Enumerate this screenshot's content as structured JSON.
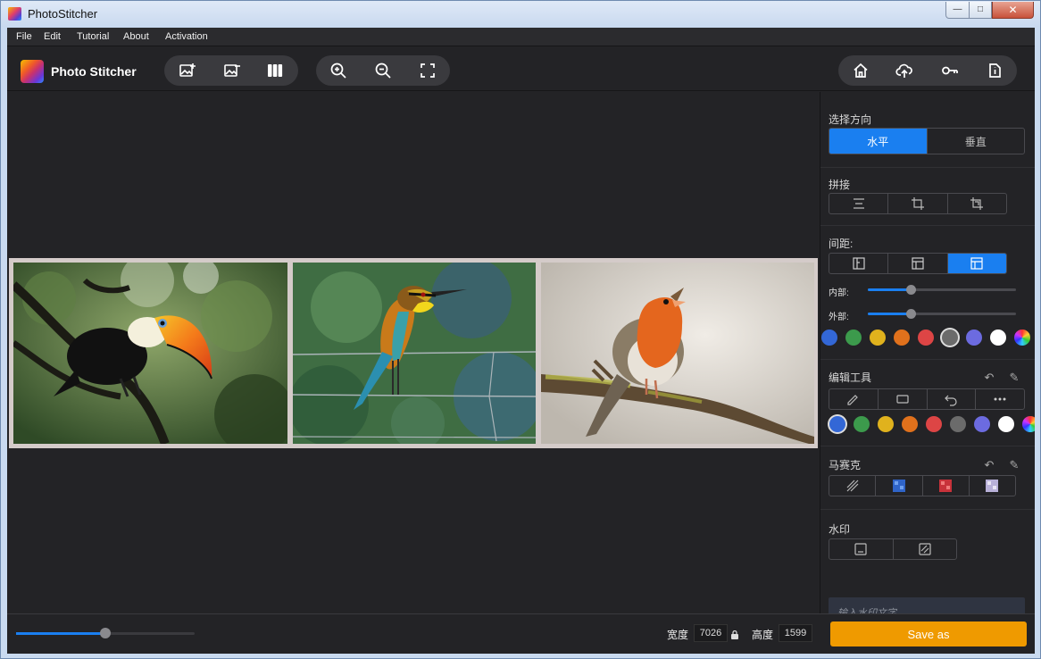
{
  "window": {
    "title": "PhotoStitcher",
    "controls": {
      "minimize": "—",
      "maximize": "□",
      "close": "✕"
    }
  },
  "menu": [
    "File",
    "Edit",
    "Tutorial",
    "About",
    "Activation"
  ],
  "app": {
    "name": "Photo Stitcher"
  },
  "toolbar": {
    "group1": [
      "add-image-icon",
      "remove-image-icon",
      "columns-icon"
    ],
    "group2": [
      "zoom-in-icon",
      "zoom-out-icon",
      "fit-screen-icon"
    ],
    "group3": [
      "home-icon",
      "upload-icon",
      "key-icon",
      "info-icon"
    ]
  },
  "photos": [
    {
      "name": "toucan-photo"
    },
    {
      "name": "bee-eater-photo"
    },
    {
      "name": "robin-photo"
    }
  ],
  "panel": {
    "direction": {
      "label": "选择方向",
      "options": [
        "水平",
        "垂直"
      ],
      "selected": 0
    },
    "stitch": {
      "label": "拼接"
    },
    "spacing": {
      "label": "间距:",
      "selected": 2,
      "inner_label": "内部:",
      "outer_label": "外部:",
      "inner_value": 0.29,
      "outer_value": 0.29
    },
    "colors1": {
      "colors": [
        "#3367d6",
        "#3c9a4c",
        "#e0b21d",
        "#e0711c",
        "#dd4545",
        "#6b6b6b",
        "#6c6be0",
        "#ffffff",
        "rainbow"
      ],
      "selected": 5
    },
    "edit_tools": {
      "label": "编辑工具"
    },
    "colors2": {
      "colors": [
        "#3367d6",
        "#3c9a4c",
        "#e0b21d",
        "#e0711c",
        "#dd4545",
        "#6b6b6b",
        "#6c6be0",
        "#ffffff",
        "rainbow"
      ],
      "selected": 0
    },
    "mosaic": {
      "label": "马赛克"
    },
    "watermark": {
      "label": "水印",
      "placeholder": "输入水印文字"
    }
  },
  "bottom": {
    "zoom_value": 0.5,
    "width_label": "宽度",
    "width_value": "7026",
    "height_label": "高度",
    "height_value": "1599",
    "save_label": "Save as"
  },
  "colors": {
    "accent": "#1a7ff0",
    "save": "#ef9a00"
  }
}
